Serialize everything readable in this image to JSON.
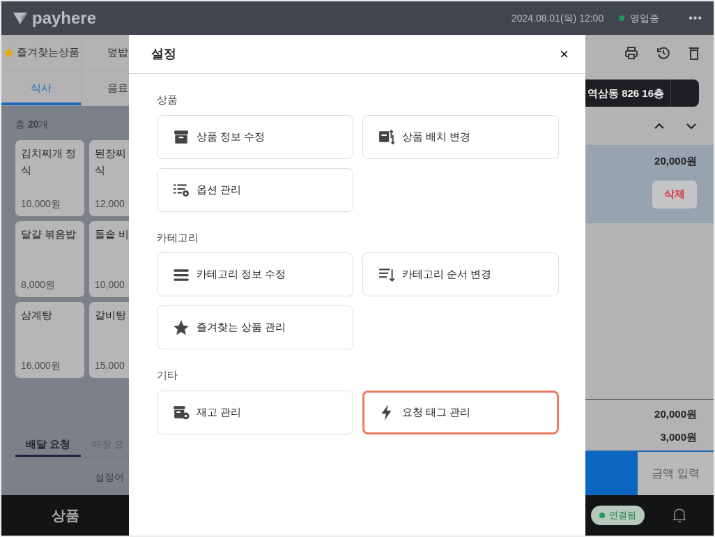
{
  "header": {
    "logo": "payhere",
    "datetime": "2024.08.01(목) 12:00",
    "status": "영업중",
    "menu": "•••"
  },
  "left": {
    "categories": [
      [
        {
          "label": "즐겨찾는상품",
          "kind": "favorite",
          "selected": false
        },
        {
          "label": "덮밥",
          "kind": "plain",
          "selected": false
        }
      ],
      [
        {
          "label": "식사",
          "kind": "plain",
          "selected": true
        },
        {
          "label": "음료",
          "kind": "plain",
          "selected": false
        }
      ]
    ],
    "count_label": "총 **20**개",
    "products": [
      {
        "name": "김치찌개 정식",
        "price": "10,000원"
      },
      {
        "name": "된장찌",
        "name_2": "식",
        "price": "12,000"
      },
      {
        "name": "달걀 볶음밥",
        "price": "8,000원"
      },
      {
        "name": "돌솥 비",
        "price": "10,000"
      },
      {
        "name": "삼계탕",
        "price": "16,000원"
      },
      {
        "name": "갈비탕",
        "price": "15,000"
      }
    ],
    "request_tabs": [
      {
        "label": "배달 요청",
        "selected": true
      },
      {
        "label": "매장 요",
        "selected": false
      }
    ],
    "notice": "설정어",
    "nav": "상품"
  },
  "modal": {
    "title": "설정",
    "close": "×",
    "sections": [
      {
        "title": "상품",
        "items": [
          {
            "label": "상품 정보 수정",
            "kind": "box",
            "highlighted": false
          },
          {
            "label": "상품 배치 변경",
            "kind": "arrange",
            "highlighted": false
          },
          {
            "label": "옵션 관리",
            "kind": "options",
            "highlighted": false
          }
        ]
      },
      {
        "title": "카테고리",
        "items": [
          {
            "label": "카테고리 정보 수정",
            "kind": "list",
            "highlighted": false
          },
          {
            "label": "카테고리 순서 변경",
            "kind": "sort",
            "highlighted": false
          },
          {
            "label": "즐겨찾는 상품 관리",
            "kind": "star",
            "highlighted": false
          }
        ]
      },
      {
        "title": "기타",
        "items": [
          {
            "label": "재고 관리",
            "kind": "stock",
            "highlighted": false
          },
          {
            "label": "요청 태그 관리",
            "kind": "bolt",
            "highlighted": true
          }
        ]
      }
    ]
  },
  "right": {
    "address": "역삼동 826 16층",
    "order_price": "20,000원",
    "delete": "삭제",
    "totals": [
      "20,000원",
      "3,000원"
    ],
    "amount_button": "금액 입력",
    "connection": "연결됨"
  }
}
